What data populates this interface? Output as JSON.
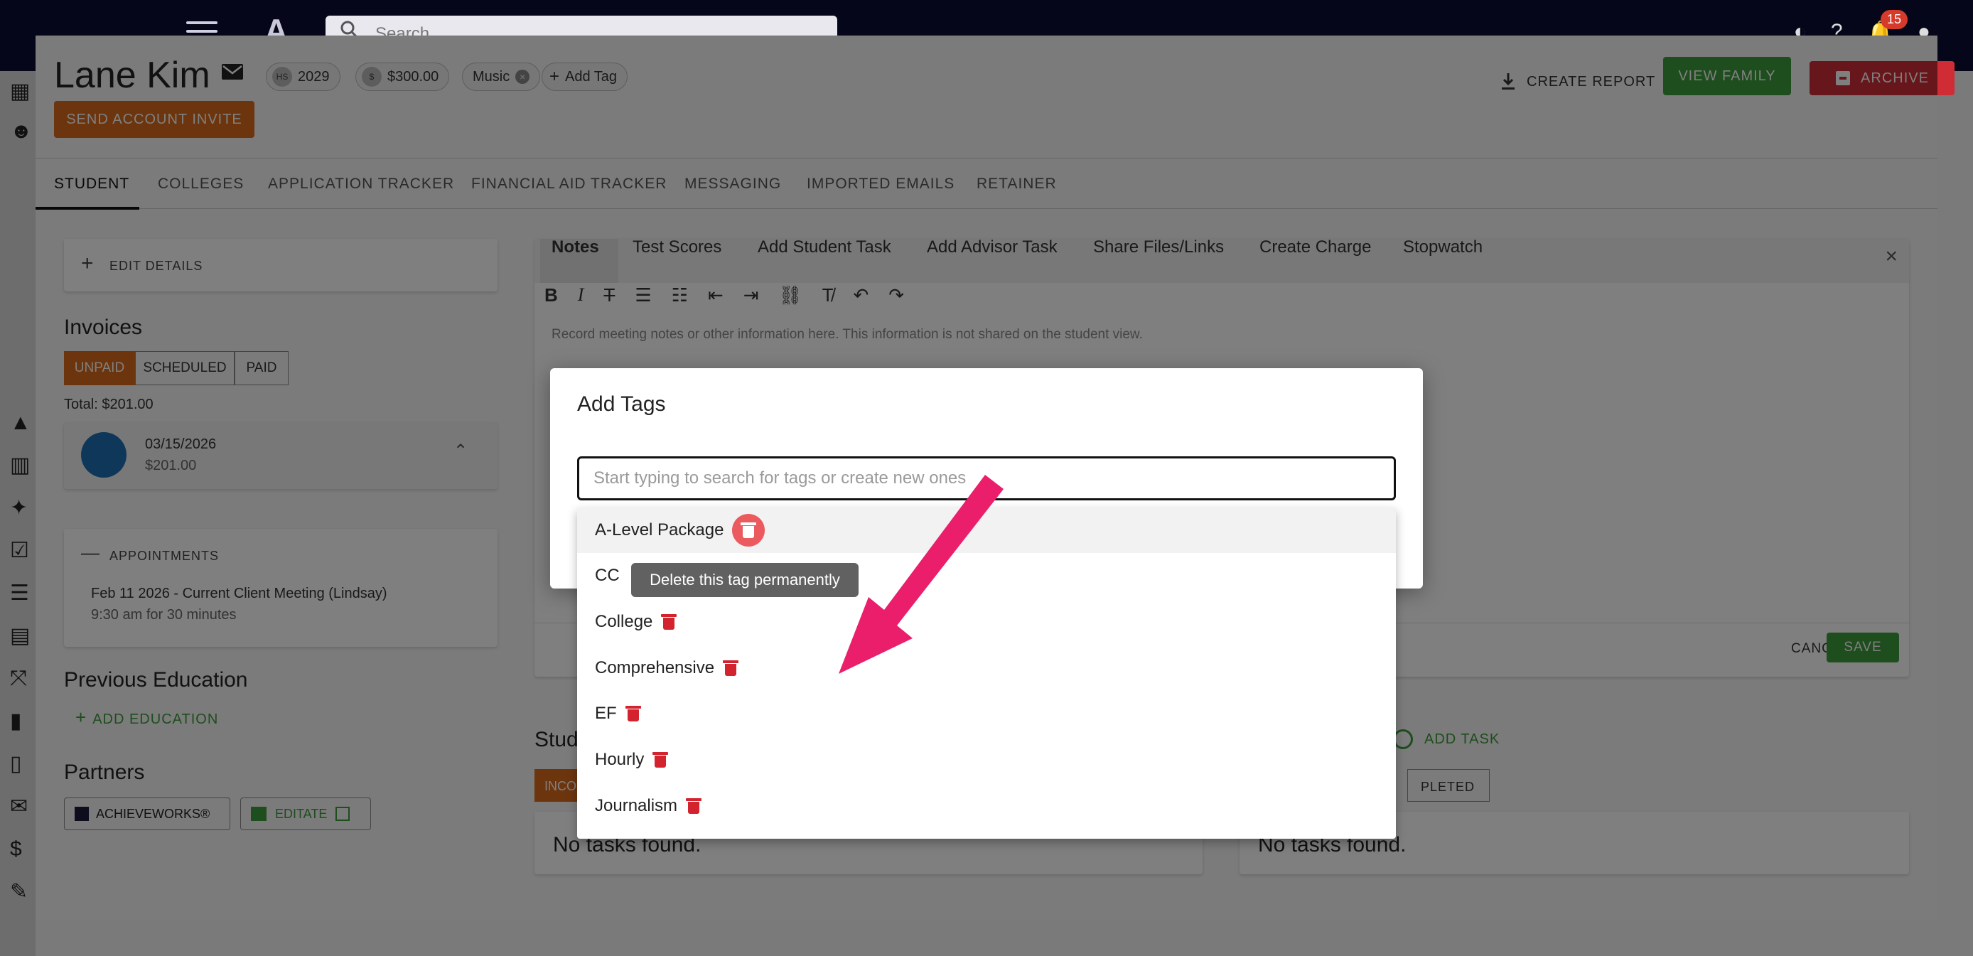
{
  "topbar": {
    "search_placeholder": "Search",
    "notification_count": "15"
  },
  "student": {
    "name": "Lane Kim",
    "chips": {
      "grad_prefix": "HS",
      "grad_year": "2029",
      "balance_prefix": "$",
      "balance": "$300.00",
      "tag": "Music",
      "add_tag": "Add Tag"
    },
    "send_invite": "SEND ACCOUNT INVITE"
  },
  "header_actions": {
    "create_report": "CREATE REPORT",
    "view_family": "VIEW FAMILY",
    "archive": "ARCHIVE"
  },
  "tabs": [
    "STUDENT",
    "COLLEGES",
    "APPLICATION TRACKER",
    "FINANCIAL AID TRACKER",
    "MESSAGING",
    "IMPORTED EMAILS",
    "RETAINER"
  ],
  "left": {
    "edit_details": "EDIT DETAILS",
    "invoices_title": "Invoices",
    "invoice_filters": [
      "UNPAID",
      "SCHEDULED",
      "PAID"
    ],
    "total": "Total: $201.00",
    "invoice": {
      "date": "03/15/2026",
      "amount": "$201.00"
    },
    "appointments_title": "APPOINTMENTS",
    "appointment": {
      "title": "Feb 11 2026 - Current Client Meeting (Lindsay)",
      "time": "9:30 am for 30 minutes"
    },
    "prev_education_title": "Previous Education",
    "add_education": "ADD EDUCATION",
    "partners_title": "Partners",
    "partners": [
      "ACHIEVEWORKS®",
      "EDITATE"
    ]
  },
  "notes": {
    "tabs": [
      "Notes",
      "Test Scores",
      "Add Student Task",
      "Add Advisor Task",
      "Share Files/Links",
      "Create Charge",
      "Stopwatch"
    ],
    "placeholder": "Record meeting notes or other information here. This information is not shared on the student view.",
    "cancel": "CANCEL",
    "save": "SAVE"
  },
  "tasks": {
    "title_fragment": "Stud",
    "filter_fragment": "INCO",
    "completed_fragment": "PLETED",
    "add_task": "ADD TASK",
    "empty": "No tasks found."
  },
  "dialog": {
    "title": "Add Tags",
    "input_placeholder": "Start typing to search for tags or create new ones",
    "options": [
      "A-Level Package",
      "CC",
      "College",
      "Comprehensive",
      "EF",
      "Hourly",
      "Journalism"
    ],
    "tooltip": "Delete this tag permanently"
  },
  "colors": {
    "accent_orange": "#d96a1c",
    "green": "#3d9b3d",
    "red": "#cf2c36",
    "arrow_pink": "#ea1e6a"
  }
}
